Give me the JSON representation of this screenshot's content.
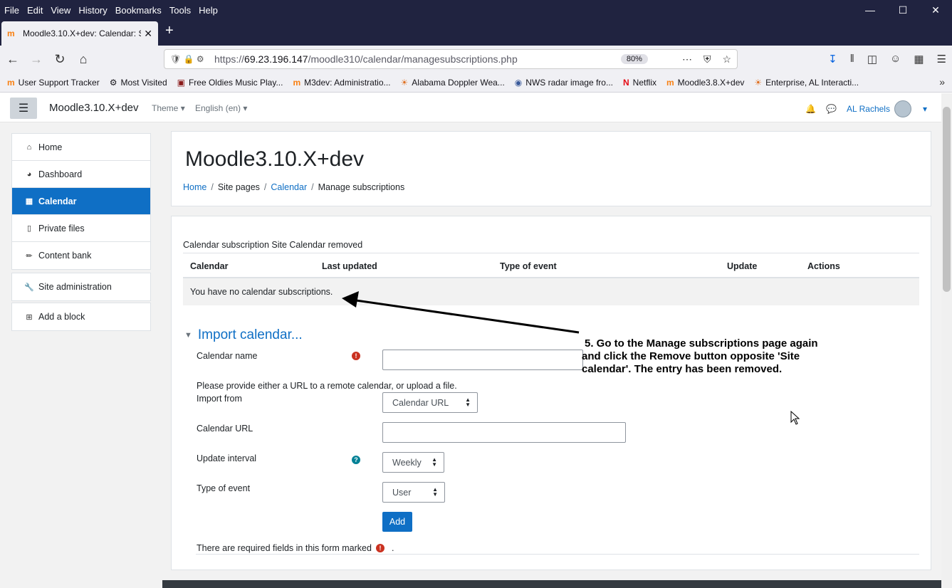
{
  "browser": {
    "menu": [
      "File",
      "Edit",
      "View",
      "History",
      "Bookmarks",
      "Tools",
      "Help"
    ],
    "tab_title": "Moodle3.10.X+dev: Calendar: S",
    "url_scheme": "https://",
    "url_host": "69.23.196.147",
    "url_path": "/moodle310/calendar/managesubscriptions.php",
    "zoom": "80%",
    "bookmarks": [
      {
        "label": "User Support Tracker",
        "icon": "moodle-icon"
      },
      {
        "label": "Most Visited",
        "icon": "gear-icon"
      },
      {
        "label": "Free Oldies Music Play...",
        "icon": "radio-icon"
      },
      {
        "label": "M3dev: Administratio...",
        "icon": "moodle-icon"
      },
      {
        "label": "Alabama Doppler Wea...",
        "icon": "weather-icon"
      },
      {
        "label": "NWS radar image fro...",
        "icon": "nws-icon"
      },
      {
        "label": "Netflix",
        "icon": "netflix-icon"
      },
      {
        "label": "Moodle3.8.X+dev",
        "icon": "moodle-icon"
      },
      {
        "label": "Enterprise, AL Interacti...",
        "icon": "weather-icon"
      }
    ]
  },
  "moodle": {
    "site_name": "Moodle3.10.X+dev",
    "menu_theme": "Theme",
    "menu_lang": "English (en)",
    "user_name": "AL Rachels",
    "nav": {
      "home": "Home",
      "dashboard": "Dashboard",
      "calendar": "Calendar",
      "private_files": "Private files",
      "content_bank": "Content bank",
      "site_admin": "Site administration",
      "add_block": "Add a block"
    },
    "page_title": "Moodle3.10.X+dev",
    "breadcrumb": [
      "Home",
      "Site pages",
      "Calendar",
      "Manage subscriptions"
    ],
    "notice": "Calendar subscription Site Calendar removed",
    "table_headers": [
      "Calendar",
      "Last updated",
      "Type of event",
      "Update",
      "Actions"
    ],
    "table_empty": "You have no calendar subscriptions.",
    "import_heading": "Import calendar...",
    "form": {
      "calendar_name_label": "Calendar name",
      "calendar_name_value": "",
      "help_text": "Please provide either a URL to a remote calendar, or upload a file.",
      "import_from_label": "Import from",
      "import_from_value": "Calendar URL",
      "calendar_url_label": "Calendar URL",
      "calendar_url_value": "",
      "update_interval_label": "Update interval",
      "update_interval_value": "Weekly",
      "type_of_event_label": "Type of event",
      "type_of_event_value": "User",
      "add_button": "Add",
      "required_note": "There are required fields in this form marked",
      "required_note_end": "."
    }
  },
  "annotation": {
    "line1": "5. Go to the Manage subscriptions page again",
    "line2": "and click the Remove button opposite 'Site",
    "line3": "calendar'. The entry has been removed."
  },
  "colors": {
    "accent": "#0f6fc5",
    "browser_dark": "#202340",
    "required": "#ca3120",
    "help": "#008196"
  }
}
